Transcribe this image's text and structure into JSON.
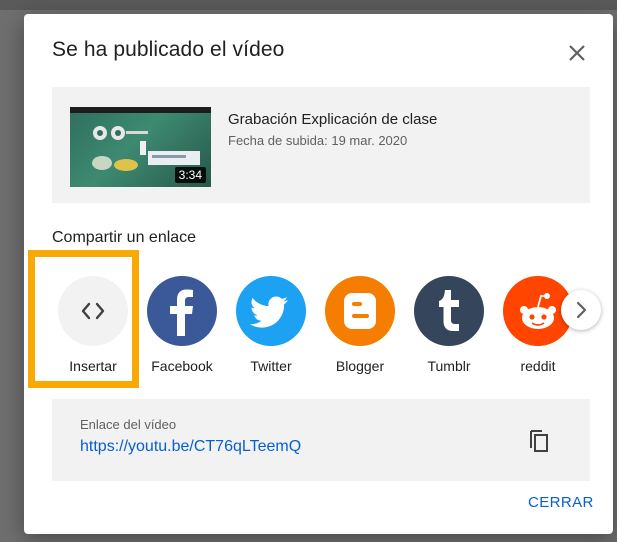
{
  "dialog": {
    "title": "Se ha publicado el vídeo",
    "close_icon": "close-icon"
  },
  "video": {
    "title": "Grabación Explicación de clase",
    "upload_date": "Fecha de subida: 19 mar. 2020",
    "duration": "3:34"
  },
  "share": {
    "heading": "Compartir un enlace",
    "items": [
      {
        "label": "Insertar",
        "icon": "embed-code-icon",
        "color": "#f2f2f2"
      },
      {
        "label": "Facebook",
        "icon": "facebook-icon",
        "color": "#3b5998"
      },
      {
        "label": "Twitter",
        "icon": "twitter-icon",
        "color": "#1da1f2"
      },
      {
        "label": "Blogger",
        "icon": "blogger-icon",
        "color": "#f57d00"
      },
      {
        "label": "Tumblr",
        "icon": "tumblr-icon",
        "color": "#35465c"
      },
      {
        "label": "reddit",
        "icon": "reddit-icon",
        "color": "#ff4500"
      }
    ],
    "next_icon": "chevron-right-icon",
    "highlight_color": "#f9a904"
  },
  "link": {
    "label": "Enlace del vídeo",
    "url": "https://youtu.be/CT76qLTeemQ",
    "copy_icon": "copy-icon"
  },
  "footer": {
    "close_label": "CERRAR"
  },
  "colors": {
    "accent": "#065fd4",
    "panel": "#f2f2f2"
  }
}
